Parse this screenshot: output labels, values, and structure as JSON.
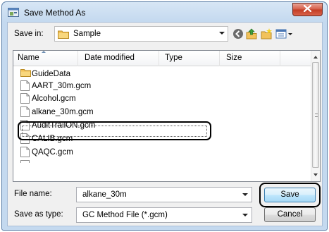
{
  "window": {
    "title": "Save Method As"
  },
  "toolbar": {
    "save_in_label": "Save in:",
    "save_in_value": "Sample",
    "icons": [
      "back-icon",
      "up-folder-icon",
      "new-folder-icon",
      "views-menu-icon"
    ]
  },
  "columns": {
    "name": "Name",
    "date_modified": "Date modified",
    "type": "Type",
    "size": "Size"
  },
  "files": [
    {
      "label": "GuideData",
      "icon": "folder-icon"
    },
    {
      "label": "AART_30m.gcm",
      "icon": "file-icon"
    },
    {
      "label": "Alcohol.gcm",
      "icon": "file-icon"
    },
    {
      "label": "alkane_30m.gcm",
      "icon": "file-icon"
    },
    {
      "label": "AuditTrailON.gcm",
      "icon": "file-icon"
    },
    {
      "label": "CALIB.gcm",
      "icon": "file-icon"
    },
    {
      "label": "QAQC.gcm",
      "icon": "file-icon"
    }
  ],
  "fields": {
    "file_name_label": "File name:",
    "file_name_value": "alkane_30m",
    "save_as_type_label": "Save as type:",
    "save_as_type_value": "GC Method File (*.gcm)"
  },
  "buttons": {
    "save": "Save",
    "cancel": "Cancel"
  },
  "colors": {
    "title_gradient_top": "#d7e6f5",
    "close_button": "#c94b33",
    "selection_border": "#000000"
  }
}
